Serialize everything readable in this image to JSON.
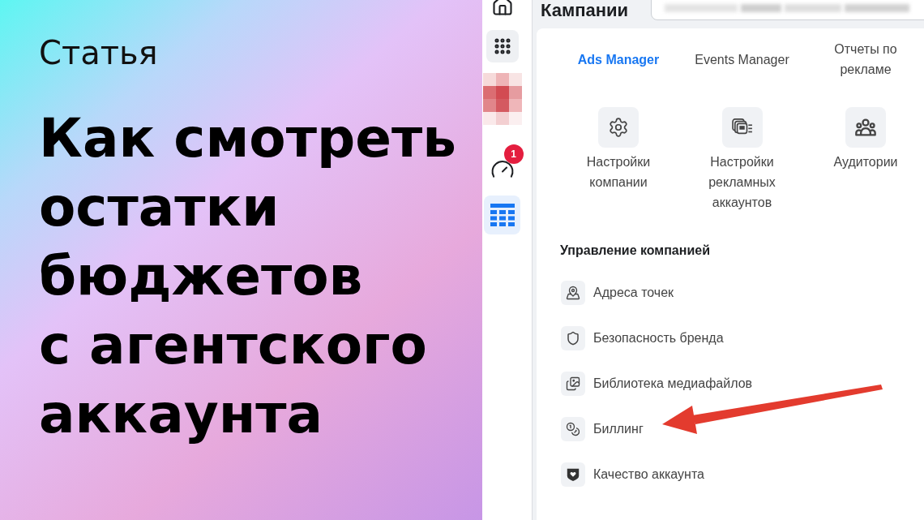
{
  "article": {
    "label": "Статья",
    "title_lines": [
      "Как смотреть",
      "остатки",
      "бюджетов",
      "с агентского",
      "аккаунта"
    ]
  },
  "sidebar": {
    "items": [
      {
        "kind": "home",
        "selected": false
      },
      {
        "kind": "apps",
        "selected": false,
        "expanded": true
      },
      {
        "kind": "avatar"
      },
      {
        "kind": "performance",
        "selected": false,
        "badge": "1"
      },
      {
        "kind": "table",
        "selected": true
      }
    ]
  },
  "header": {
    "title": "Кампании"
  },
  "tools_menu": {
    "tabs": [
      {
        "label": "Ads Manager",
        "selected": true
      },
      {
        "label": "Events Manager",
        "selected": false
      },
      {
        "label": "Отчеты по рекламе",
        "selected": false
      }
    ],
    "shortcuts": [
      {
        "label": "Настройки компании"
      },
      {
        "label": "Настройки рекламных аккаунтов"
      },
      {
        "label": "Аудитории"
      }
    ],
    "section": {
      "title": "Управление компанией",
      "items": [
        {
          "label": "Адреса точек",
          "arrow": false
        },
        {
          "label": "Безопасность бренда",
          "arrow": false
        },
        {
          "label": "Библиотека медиафайлов",
          "arrow": false
        },
        {
          "label": "Биллинг",
          "arrow": true
        },
        {
          "label": "Качество аккаунта",
          "arrow": false
        }
      ]
    }
  }
}
